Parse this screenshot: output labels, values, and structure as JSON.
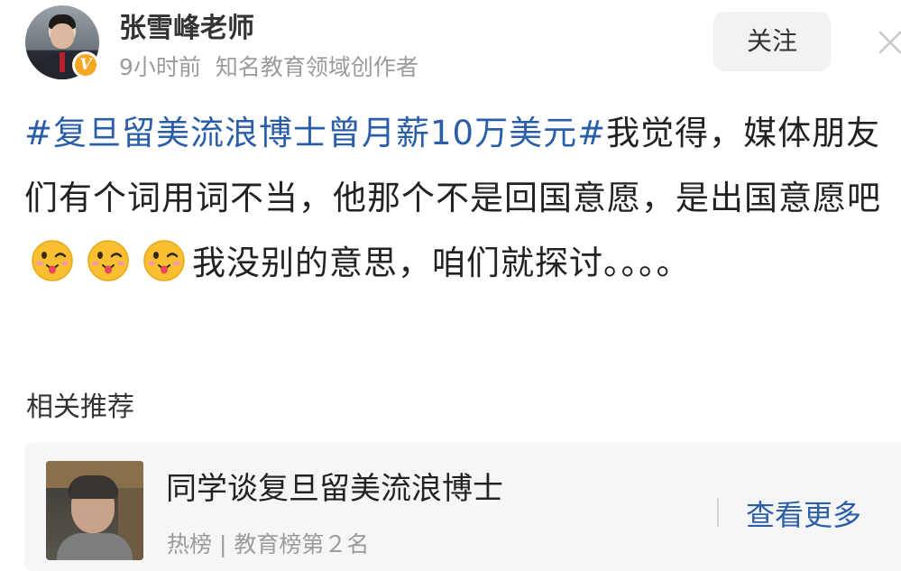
{
  "post": {
    "author": {
      "name": "张雪峰老师",
      "verified_badge": "V"
    },
    "meta": {
      "time": "9小时前",
      "description": "知名教育领域创作者"
    },
    "follow_label": "关注",
    "content": {
      "hashtag": "#复旦留美流浪博士曾月薪10万美元#",
      "text_before_emoji": "我觉得，媒体朋友们有个词用词不当，他那个不是回国意愿，是出国意愿吧",
      "emojis": [
        "wink-tongue-emoji",
        "wink-tongue-emoji",
        "wink-tongue-emoji"
      ],
      "text_after_emoji": "我没别的意思，咱们就探讨。。。。"
    }
  },
  "related": {
    "title": "相关推荐",
    "card": {
      "title": "同学谈复旦留美流浪博士",
      "source": "热榜",
      "separator": "|",
      "rank_text": "教育榜第２名",
      "more_label": "查看更多"
    }
  },
  "colors": {
    "hashtag": "#2b5ea8",
    "link": "#2b5ea8",
    "badge": "#f5a623",
    "meta": "#9b9b9b"
  },
  "icons": {
    "close": "close-icon",
    "verified": "verified-badge-icon"
  }
}
